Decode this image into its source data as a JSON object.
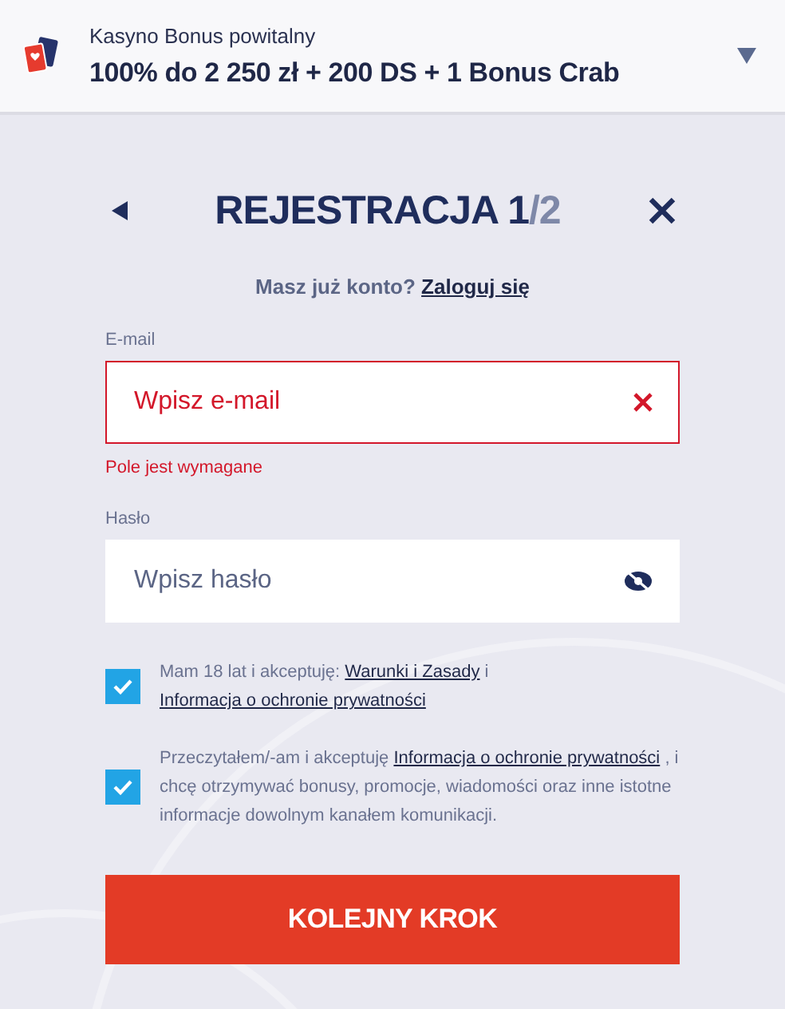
{
  "bonus_bar": {
    "label": "Kasyno Bonus powitalny",
    "offer": "100% do 2 250 zł + 200 DS + 1 Bonus Crab",
    "expanded": false
  },
  "title": "REJESTRACJA 1",
  "title_suffix": "/2",
  "login_prompt": {
    "text": "Masz już konto?",
    "link": "Zaloguj się"
  },
  "fields": [
    {
      "kind": "email",
      "label": "E-mail",
      "placeholder": "Wpisz e-mail",
      "error": "Pole jest wymagane"
    },
    {
      "kind": "password",
      "label": "Hasło",
      "placeholder": "Wpisz hasło"
    }
  ],
  "consents": [
    {
      "checked": true,
      "parts": [
        {
          "text": "Mam 18 lat i akceptuję: "
        },
        {
          "link": "Warunki i Zasady"
        },
        {
          "text": " i "
        },
        {
          "link": "Informacja o ochronie prywatności"
        }
      ]
    },
    {
      "checked": true,
      "parts": [
        {
          "text": "Przeczytałem/-am i akceptuję "
        },
        {
          "link": "Informacja o ochronie prywatności"
        },
        {
          "text": " , i chcę otrzymywać bonusy, promocje, wiadomości oraz inne istotne informacje dowolnym kanałem komunikacji."
        }
      ]
    }
  ],
  "submit": "KOLEJNY KROK"
}
